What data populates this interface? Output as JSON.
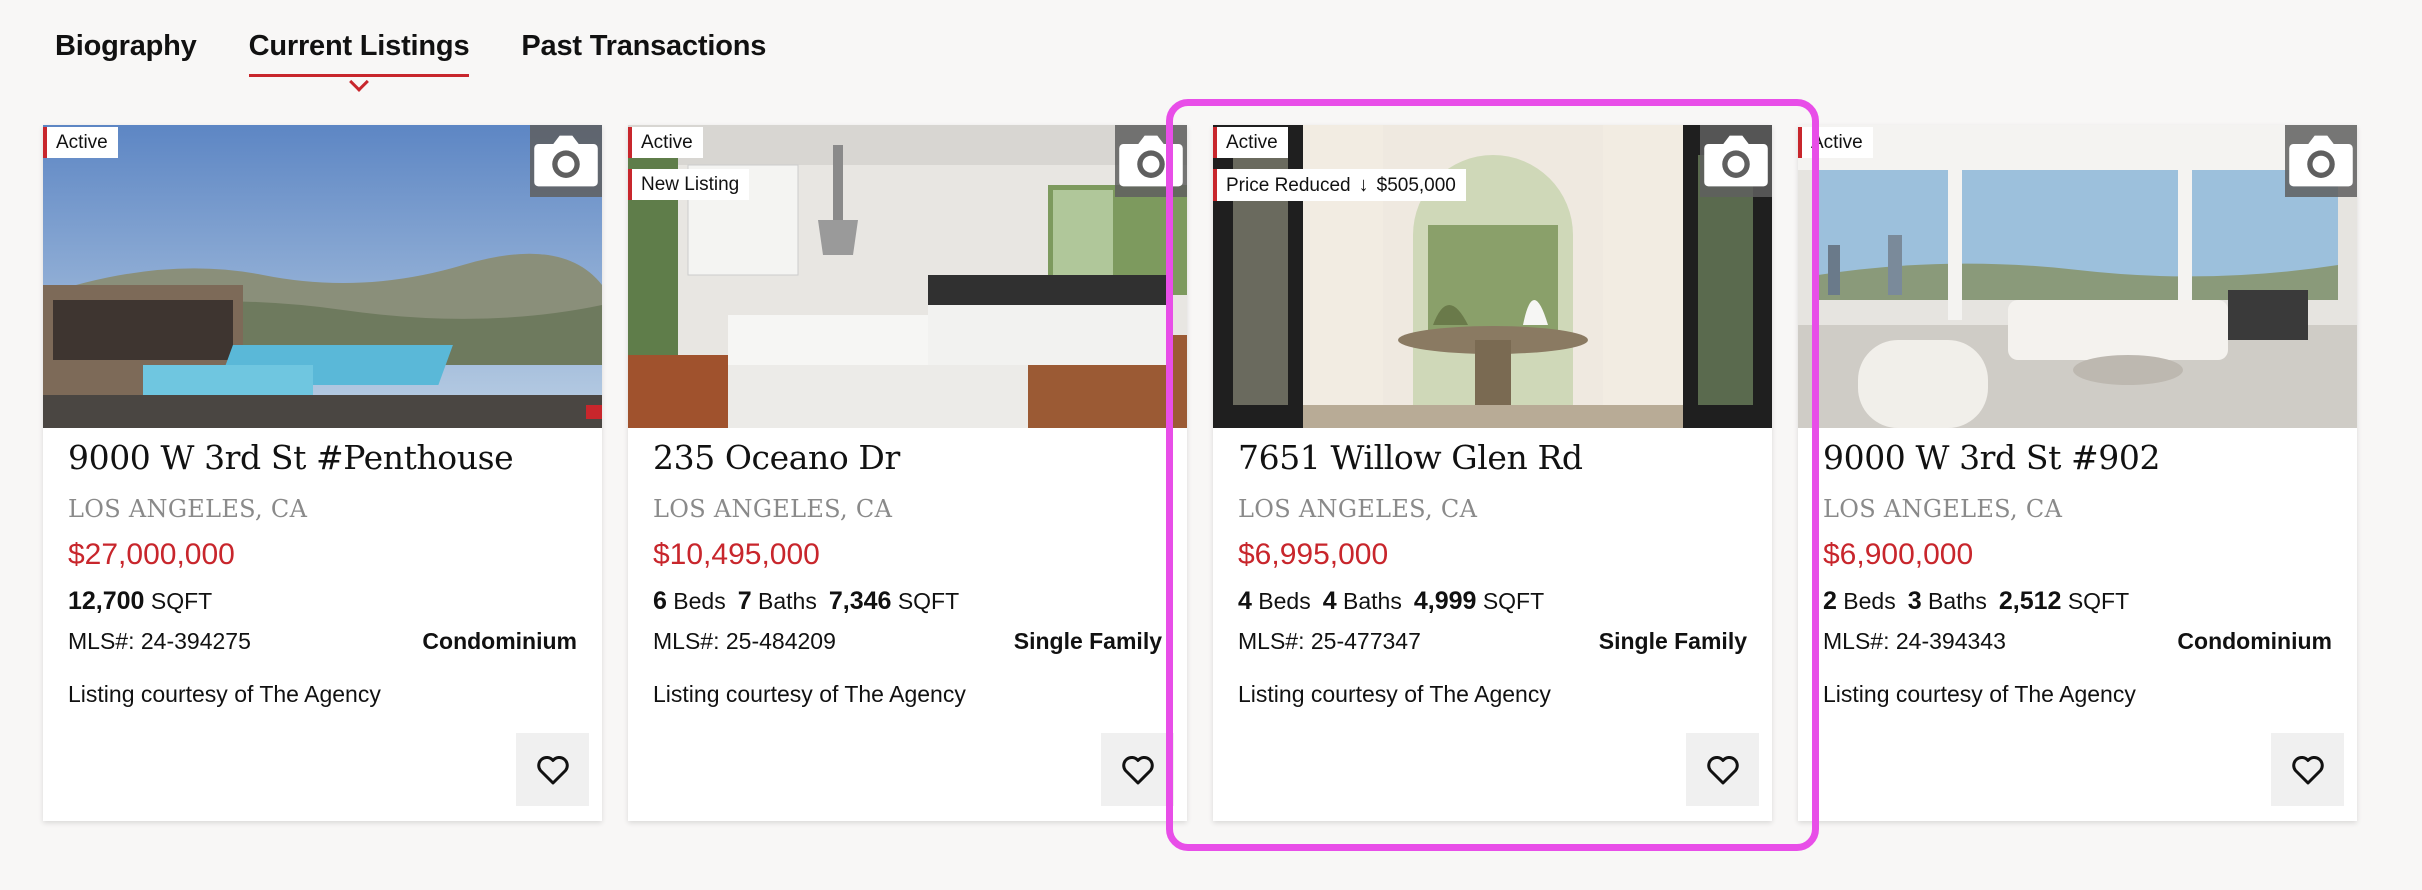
{
  "tabs": [
    {
      "label": "Biography"
    },
    {
      "label": "Current Listings"
    },
    {
      "label": "Past Transactions"
    }
  ],
  "listings": [
    {
      "badges": [
        "Active"
      ],
      "address": "9000 W 3rd St #Penthouse",
      "city": "LOS ANGELES, CA",
      "price": "$27,000,000",
      "sqft": "12,700",
      "sqft_label": "SQFT",
      "mls": "MLS#: 24-394275",
      "property_type": "Condominium",
      "courtesy": "Listing courtesy of The Agency"
    },
    {
      "badges": [
        "Active",
        "New Listing"
      ],
      "address": "235 Oceano Dr",
      "city": "LOS ANGELES, CA",
      "price": "$10,495,000",
      "beds": "6",
      "beds_label": "Beds",
      "baths": "7",
      "baths_label": "Baths",
      "sqft": "7,346",
      "sqft_label": "SQFT",
      "mls": "MLS#: 25-484209",
      "property_type": "Single Family",
      "courtesy": "Listing courtesy of The Agency"
    },
    {
      "badges": [
        "Active"
      ],
      "price_reduced": {
        "label": "Price Reduced",
        "arrow": "↓",
        "amount": "$505,000"
      },
      "address": "7651 Willow Glen Rd",
      "city": "LOS ANGELES, CA",
      "price": "$6,995,000",
      "beds": "4",
      "beds_label": "Beds",
      "baths": "4",
      "baths_label": "Baths",
      "sqft": "4,999",
      "sqft_label": "SQFT",
      "mls": "MLS#: 25-477347",
      "property_type": "Single Family",
      "courtesy": "Listing courtesy of The Agency"
    },
    {
      "badges": [
        "Active"
      ],
      "address": "9000 W 3rd St #902",
      "city": "LOS ANGELES, CA",
      "price": "$6,900,000",
      "beds": "2",
      "beds_label": "Beds",
      "baths": "3",
      "baths_label": "Baths",
      "sqft": "2,512",
      "sqft_label": "SQFT",
      "mls": "MLS#: 24-394343",
      "property_type": "Condominium",
      "courtesy": "Listing courtesy of The Agency"
    }
  ],
  "colors": {
    "accent_red": "#c8262c",
    "highlight": "#e84ee8",
    "background": "#f8f7f6"
  },
  "icons": [
    "camera-icon",
    "heart-icon",
    "arrow-down-icon"
  ]
}
